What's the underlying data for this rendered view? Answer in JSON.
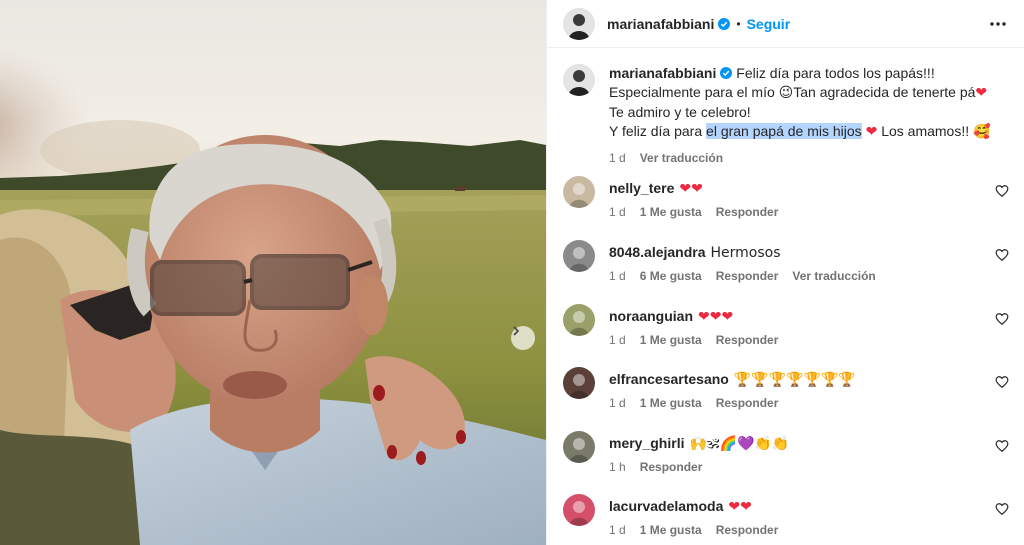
{
  "post": {
    "username": "marianafabbiani",
    "follow_label": "Seguir",
    "dot": "•",
    "more_icon": "more-options-icon"
  },
  "caption": {
    "username": "marianafabbiani",
    "line1": "Feliz día para todos los papás!!!",
    "line2a": "Especialmente para el mío ",
    "emoji_smile": "😉",
    "line2b": "Tan agradecida de tenerte pá",
    "line3": "Te admiro y te celebro!",
    "line4a": "Y feliz día para ",
    "line4_highlight": "el gran papá de mis hijos",
    "line4b": " Los amamos!! ",
    "emoji_love": "🥰",
    "heart": "❤",
    "time": "1 d",
    "translate": "Ver traducción"
  },
  "comments": [
    {
      "user": "nelly_tere",
      "text": "",
      "hearts": "❤❤",
      "time": "1 d",
      "likes": "1 Me gusta",
      "reply": "Responder",
      "translate": ""
    },
    {
      "user": "8048.alejandra",
      "text": "Hermosos",
      "hearts": "",
      "time": "1 d",
      "likes": "6 Me gusta",
      "reply": "Responder",
      "translate": "Ver traducción"
    },
    {
      "user": "noraanguian",
      "text": "",
      "hearts": "❤❤❤",
      "time": "1 d",
      "likes": "1 Me gusta",
      "reply": "Responder",
      "translate": ""
    },
    {
      "user": "elfrancesartesano",
      "text": "🏆🏆🏆🏆🏆🏆🏆",
      "hearts": "",
      "time": "1 d",
      "likes": "1 Me gusta",
      "reply": "Responder",
      "translate": ""
    },
    {
      "user": "mery_ghirli",
      "text": "🙌🕉🌈💜👏👏",
      "hearts": "",
      "time": "1 h",
      "likes": "",
      "reply": "Responder",
      "translate": ""
    },
    {
      "user": "lacurvadelamoda",
      "text": "",
      "hearts": "❤❤",
      "time": "1 d",
      "likes": "1 Me gusta",
      "reply": "Responder",
      "translate": ""
    }
  ],
  "colors": {
    "follow": "#0095f6",
    "verified": "#0095f6",
    "highlight": "#b4d5fe",
    "heart": "#ed2a3f",
    "meta": "#737373"
  }
}
